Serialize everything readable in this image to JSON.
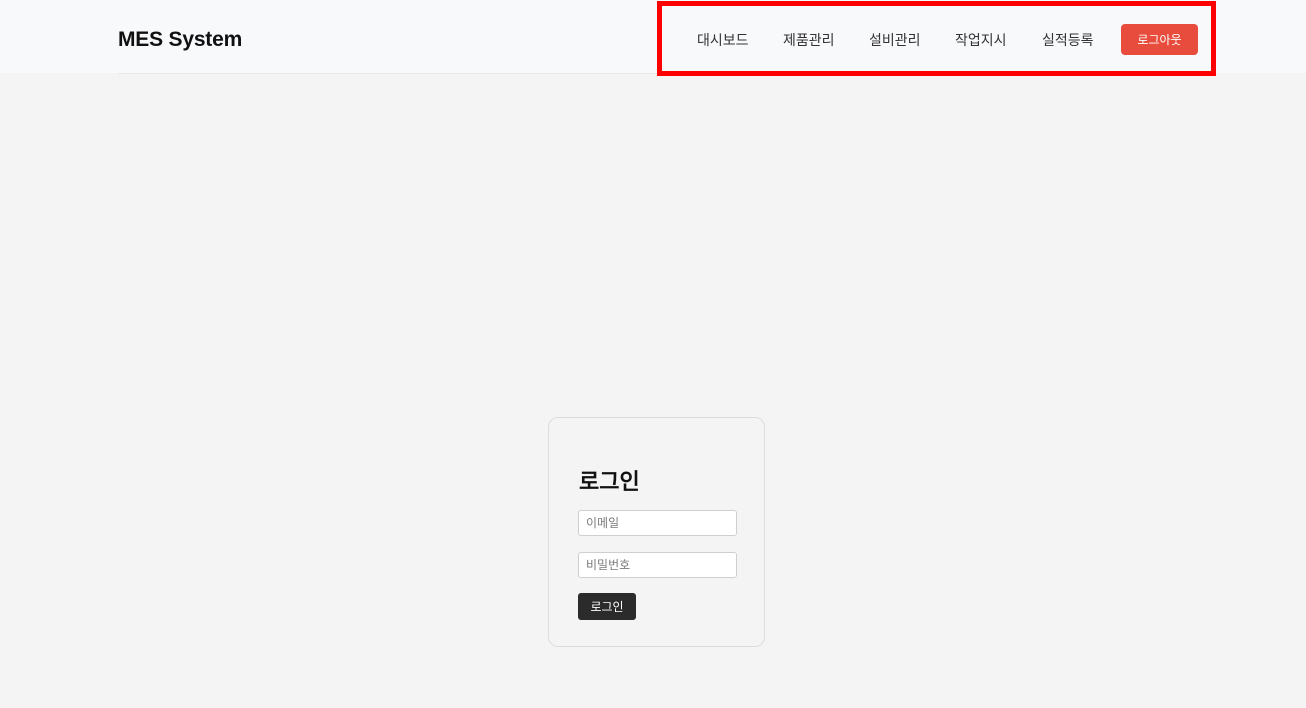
{
  "header": {
    "brand": "MES System",
    "nav": [
      {
        "label": "대시보드"
      },
      {
        "label": "제품관리"
      },
      {
        "label": "설비관리"
      },
      {
        "label": "작업지시"
      },
      {
        "label": "실적등록"
      }
    ],
    "logout_label": "로그아웃"
  },
  "login": {
    "title": "로그인",
    "email_placeholder": "이메일",
    "password_placeholder": "비밀번호",
    "submit_label": "로그인"
  },
  "colors": {
    "accent": "#e74c3c",
    "primary_button": "#2b2b2b",
    "highlight": "#ff0000"
  }
}
